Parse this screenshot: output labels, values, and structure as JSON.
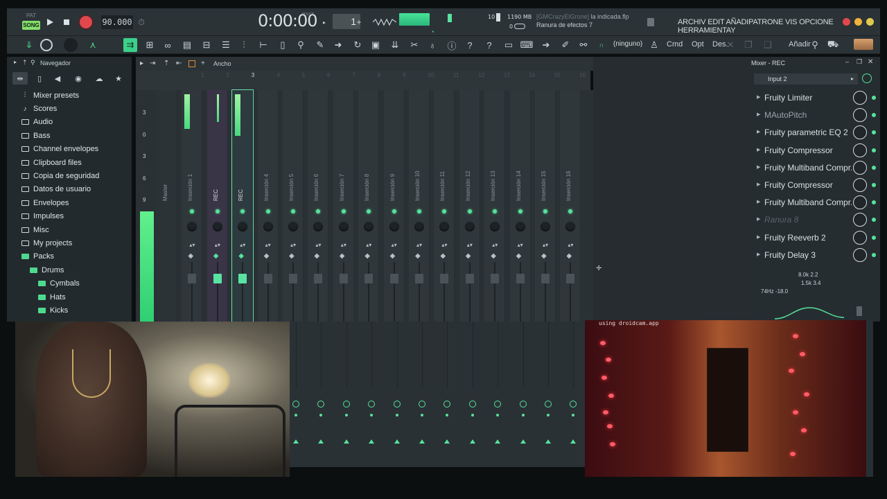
{
  "transport": {
    "pat_label": "PAT",
    "song_label": "SONG",
    "tempo": "90.000",
    "time": "0:00:00",
    "time_sub": "M:S:CS",
    "pattern_number": "1",
    "cpu_value": "10",
    "memory": "1190 MB",
    "voices": "0",
    "hint_user": "[GMCrazyElGrone]",
    "hint_song": "la indicada.flp",
    "hint_panel": "Ranura de efectos 7"
  },
  "menu": {
    "items": [
      "ARCHIV",
      "EDIT",
      "AÑADIR",
      "PATRONE",
      "VIS",
      "OPCIONE",
      "HERRAMIENTAS",
      "?"
    ],
    "text": "ARCHIV EDIT AÑADIPATRONE VIS OPCIONE HERRAMIENTAY"
  },
  "toolbar": {
    "preset_label": "(ninguno)",
    "cmd_label": "Cmd",
    "opt_label": "Opt",
    "des_label": "Des.",
    "add_label": "Añadir"
  },
  "browser": {
    "title": "Navegador",
    "items": [
      {
        "label": "Mixer presets",
        "icon": "mixer-presets-icon",
        "indent": 0
      },
      {
        "label": "Scores",
        "icon": "note-icon",
        "indent": 0
      },
      {
        "label": "Audio",
        "icon": "folder-icon",
        "indent": 0
      },
      {
        "label": "Bass",
        "icon": "folder-icon",
        "indent": 0
      },
      {
        "label": "Channel envelopes",
        "icon": "folder-icon",
        "indent": 0
      },
      {
        "label": "Clipboard files",
        "icon": "folder-icon",
        "indent": 0
      },
      {
        "label": "Copia de seguridad",
        "icon": "folder-icon",
        "indent": 0
      },
      {
        "label": "Datos de usuario",
        "icon": "folder-icon",
        "indent": 0
      },
      {
        "label": "Envelopes",
        "icon": "folder-icon",
        "indent": 0
      },
      {
        "label": "Impulses",
        "icon": "folder-icon",
        "indent": 0
      },
      {
        "label": "Misc",
        "icon": "folder-icon",
        "indent": 0
      },
      {
        "label": "My projects",
        "icon": "folder-icon",
        "indent": 0
      },
      {
        "label": "Packs",
        "icon": "folder-open-icon",
        "indent": 0
      },
      {
        "label": "Drums",
        "icon": "folder-open-icon",
        "indent": 1
      },
      {
        "label": "Cymbals",
        "icon": "folder-open-icon",
        "indent": 2
      },
      {
        "label": "Hats",
        "icon": "folder-open-icon",
        "indent": 2
      },
      {
        "label": "Kicks",
        "icon": "folder-open-icon",
        "indent": 2
      }
    ]
  },
  "mixer": {
    "width_label": "Ancho",
    "ruler": [
      "1",
      "2",
      "3",
      "4",
      "5",
      "6",
      "7",
      "8",
      "9",
      "10",
      "11",
      "12",
      "13",
      "14",
      "15",
      "16"
    ],
    "scale": [
      "3",
      "0",
      "3",
      "6",
      "9"
    ],
    "strips": [
      "Master",
      "Inserción 1",
      "REC",
      "REC",
      "Inserción 4",
      "Inserción 5",
      "Inserción 6",
      "Inserción 7",
      "Inserción 8",
      "Inserción 9",
      "Inserción 10",
      "Inserción 11",
      "Inserción 12",
      "Inserción 13",
      "Inserción 14",
      "Inserción 15",
      "Inserción 16"
    ]
  },
  "fx_panel": {
    "title": "Mixer - REC",
    "input": "Input 2",
    "slots": [
      {
        "name": "Fruity Limiter",
        "state": "normal"
      },
      {
        "name": "MAutoPitch",
        "state": "dim"
      },
      {
        "name": "Fruity parametric EQ 2",
        "state": "normal"
      },
      {
        "name": "Fruity Compressor",
        "state": "normal"
      },
      {
        "name": "Fruity Multiband Compr...",
        "state": "normal"
      },
      {
        "name": "Fruity Compressor",
        "state": "normal"
      },
      {
        "name": "Fruity Multiband Compr...",
        "state": "normal"
      },
      {
        "name": "Ranura 8",
        "state": "empty"
      },
      {
        "name": "Fruity Reeverb 2",
        "state": "normal"
      },
      {
        "name": "Fruity Delay 3",
        "state": "normal"
      }
    ],
    "eq_top": "8.0k 2.2",
    "eq_mid": "1.5k 3.4",
    "eq_low": "74Hz -18.0"
  },
  "webcam": {
    "watermark": "using droidcam.app"
  },
  "colors": {
    "accent_green": "#56e39a",
    "record_red": "#e0484d",
    "panel_bg": "#2b3337"
  }
}
